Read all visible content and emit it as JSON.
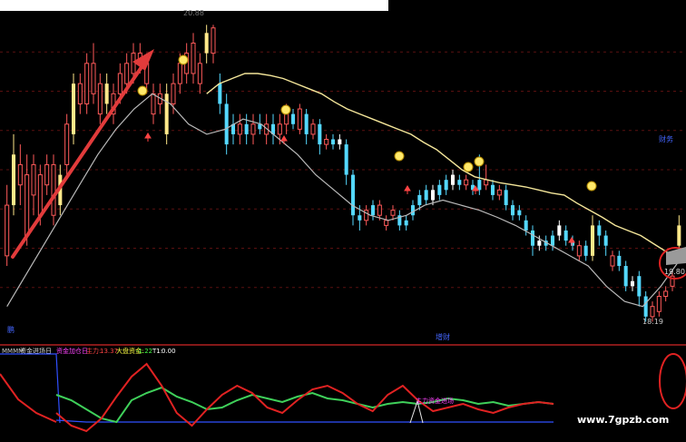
{
  "header": {
    "ticker_prefix": "MMMM",
    "indicator_name": "资金进场日",
    "indicator_name2": "资金加仓日",
    "main_force_label": "主力:",
    "main_force_value": "13.37",
    "big_money_label": "大盘资金:",
    "big_money_value": "-1.22",
    "t1_label": "T1:",
    "t1_value": "0.00"
  },
  "main_panel": {
    "high_label": "20.88",
    "low_label": "18.19",
    "price_tag": "19.80",
    "right_label": "财务",
    "left_label": "鹏",
    "bottom_label": "增财",
    "sub_annotation": "主力资金进场"
  },
  "watermark": "www.7gpzb.com",
  "colors": {
    "up": "#ff5a5a",
    "down": "#54d8ff",
    "flat": "#ffffff",
    "doji_yellow": "#ffe88a",
    "ma_yellow": "#f4e69a",
    "ma_gray": "#b9b9b9",
    "arrow_red": "#e23b3b",
    "grid_red": "#5a1010",
    "line_green": "#3fd05a",
    "line_red": "#e02222",
    "line_blue": "#3050ff"
  },
  "chart_data": {
    "type": "candlestick",
    "price_range": [
      17.9,
      21.0
    ],
    "candles": [
      {
        "o": 18.6,
        "c": 19.1,
        "h": 19.3,
        "l": 18.5,
        "k": "up"
      },
      {
        "o": 19.1,
        "c": 19.6,
        "h": 19.8,
        "l": 19.0,
        "k": "doji"
      },
      {
        "o": 19.5,
        "c": 19.3,
        "h": 19.7,
        "l": 19.1,
        "k": "up"
      },
      {
        "o": 18.8,
        "c": 19.4,
        "h": 19.6,
        "l": 18.7,
        "k": "up"
      },
      {
        "o": 19.2,
        "c": 19.5,
        "h": 19.6,
        "l": 19.0,
        "k": "up"
      },
      {
        "o": 19.0,
        "c": 19.4,
        "h": 19.5,
        "l": 18.9,
        "k": "up"
      },
      {
        "o": 19.3,
        "c": 19.5,
        "h": 19.6,
        "l": 19.2,
        "k": "up"
      },
      {
        "o": 19.0,
        "c": 19.5,
        "h": 19.6,
        "l": 18.9,
        "k": "up"
      },
      {
        "o": 19.1,
        "c": 19.4,
        "h": 19.5,
        "l": 19.0,
        "k": "doji"
      },
      {
        "o": 19.5,
        "c": 19.9,
        "h": 20.0,
        "l": 19.4,
        "k": "up"
      },
      {
        "o": 19.8,
        "c": 20.3,
        "h": 20.4,
        "l": 19.7,
        "k": "doji"
      },
      {
        "o": 20.1,
        "c": 20.3,
        "h": 20.4,
        "l": 20.0,
        "k": "up"
      },
      {
        "o": 20.1,
        "c": 20.5,
        "h": 20.6,
        "l": 20.0,
        "k": "up"
      },
      {
        "o": 20.2,
        "c": 20.5,
        "h": 20.7,
        "l": 20.1,
        "k": "up"
      },
      {
        "o": 20.0,
        "c": 20.3,
        "h": 20.4,
        "l": 19.9,
        "k": "up"
      },
      {
        "o": 20.1,
        "c": 20.3,
        "h": 20.4,
        "l": 20.0,
        "k": "doji"
      },
      {
        "o": 20.0,
        "c": 20.2,
        "h": 20.3,
        "l": 19.9,
        "k": "up"
      },
      {
        "o": 20.2,
        "c": 20.4,
        "h": 20.5,
        "l": 20.1,
        "k": "up"
      },
      {
        "o": 20.3,
        "c": 20.5,
        "h": 20.6,
        "l": 20.2,
        "k": "up"
      },
      {
        "o": 20.4,
        "c": 20.6,
        "h": 20.7,
        "l": 20.3,
        "k": "up"
      },
      {
        "o": 20.5,
        "c": 20.6,
        "h": 20.7,
        "l": 20.4,
        "k": "up"
      },
      {
        "o": 20.3,
        "c": 20.5,
        "h": 20.6,
        "l": 20.2,
        "k": "up"
      },
      {
        "o": 20.0,
        "c": 20.2,
        "h": 20.3,
        "l": 19.9,
        "k": "up"
      },
      {
        "o": 20.2,
        "c": 20.1,
        "h": 20.3,
        "l": 20.0,
        "k": "up"
      },
      {
        "o": 19.8,
        "c": 20.2,
        "h": 20.3,
        "l": 19.7,
        "k": "doji"
      },
      {
        "o": 20.1,
        "c": 20.3,
        "h": 20.4,
        "l": 20.0,
        "k": "up"
      },
      {
        "o": 20.3,
        "c": 20.5,
        "h": 20.6,
        "l": 20.2,
        "k": "up"
      },
      {
        "o": 20.4,
        "c": 20.6,
        "h": 20.7,
        "l": 20.3,
        "k": "up"
      },
      {
        "o": 20.4,
        "c": 20.7,
        "h": 20.8,
        "l": 20.3,
        "k": "up"
      },
      {
        "o": 20.5,
        "c": 20.3,
        "h": 20.6,
        "l": 20.2,
        "k": "up"
      },
      {
        "o": 20.6,
        "c": 20.8,
        "h": 20.88,
        "l": 20.5,
        "k": "doji"
      },
      {
        "o": 20.6,
        "c": 20.85,
        "h": 20.88,
        "l": 20.5,
        "k": "up"
      },
      {
        "o": 20.3,
        "c": 20.1,
        "h": 20.4,
        "l": 20.0,
        "k": "down"
      },
      {
        "o": 20.1,
        "c": 19.7,
        "h": 20.2,
        "l": 19.6,
        "k": "down"
      },
      {
        "o": 19.9,
        "c": 19.8,
        "h": 20.0,
        "l": 19.7,
        "k": "down"
      },
      {
        "o": 19.8,
        "c": 19.9,
        "h": 20.0,
        "l": 19.7,
        "k": "up"
      },
      {
        "o": 19.9,
        "c": 19.8,
        "h": 20.0,
        "l": 19.7,
        "k": "down"
      },
      {
        "o": 19.8,
        "c": 19.9,
        "h": 20.0,
        "l": 19.7,
        "k": "up"
      },
      {
        "o": 19.9,
        "c": 19.85,
        "h": 20.0,
        "l": 19.8,
        "k": "down"
      },
      {
        "o": 19.8,
        "c": 19.9,
        "h": 20.0,
        "l": 19.7,
        "k": "up"
      },
      {
        "o": 19.9,
        "c": 19.8,
        "h": 20.0,
        "l": 19.7,
        "k": "down"
      },
      {
        "o": 19.8,
        "c": 19.9,
        "h": 20.0,
        "l": 19.7,
        "k": "up"
      },
      {
        "o": 19.9,
        "c": 20.0,
        "h": 20.1,
        "l": 19.8,
        "k": "up"
      },
      {
        "o": 19.9,
        "c": 20.0,
        "h": 20.05,
        "l": 19.85,
        "k": "down"
      },
      {
        "o": 19.85,
        "c": 20.05,
        "h": 20.1,
        "l": 19.8,
        "k": "up"
      },
      {
        "o": 20.0,
        "c": 19.8,
        "h": 20.05,
        "l": 19.7,
        "k": "down"
      },
      {
        "o": 19.8,
        "c": 19.9,
        "h": 19.95,
        "l": 19.75,
        "k": "up"
      },
      {
        "o": 19.9,
        "c": 19.7,
        "h": 19.95,
        "l": 19.6,
        "k": "down"
      },
      {
        "o": 19.7,
        "c": 19.75,
        "h": 19.8,
        "l": 19.65,
        "k": "up"
      },
      {
        "o": 19.75,
        "c": 19.7,
        "h": 19.8,
        "l": 19.65,
        "k": "down"
      },
      {
        "o": 19.7,
        "c": 19.75,
        "h": 19.8,
        "l": 19.65,
        "k": "flat"
      },
      {
        "o": 19.7,
        "c": 19.4,
        "h": 19.75,
        "l": 19.3,
        "k": "down"
      },
      {
        "o": 19.4,
        "c": 19.0,
        "h": 19.45,
        "l": 18.9,
        "k": "down"
      },
      {
        "o": 19.0,
        "c": 18.95,
        "h": 19.1,
        "l": 18.85,
        "k": "down"
      },
      {
        "o": 18.95,
        "c": 19.05,
        "h": 19.1,
        "l": 18.9,
        "k": "up"
      },
      {
        "o": 19.1,
        "c": 19.0,
        "h": 19.15,
        "l": 18.95,
        "k": "down"
      },
      {
        "o": 19.0,
        "c": 19.1,
        "h": 19.15,
        "l": 18.95,
        "k": "up"
      },
      {
        "o": 18.9,
        "c": 18.95,
        "h": 19.0,
        "l": 18.85,
        "k": "up"
      },
      {
        "o": 19.0,
        "c": 19.05,
        "h": 19.1,
        "l": 18.95,
        "k": "up"
      },
      {
        "o": 19.0,
        "c": 18.9,
        "h": 19.05,
        "l": 18.85,
        "k": "down"
      },
      {
        "o": 18.9,
        "c": 18.95,
        "h": 19.0,
        "l": 18.85,
        "k": "down"
      },
      {
        "o": 19.0,
        "c": 19.1,
        "h": 19.15,
        "l": 18.95,
        "k": "down"
      },
      {
        "o": 19.1,
        "c": 19.2,
        "h": 19.25,
        "l": 19.05,
        "k": "down"
      },
      {
        "o": 19.15,
        "c": 19.25,
        "h": 19.3,
        "l": 19.1,
        "k": "down"
      },
      {
        "o": 19.15,
        "c": 19.25,
        "h": 19.3,
        "l": 19.1,
        "k": "flat"
      },
      {
        "o": 19.2,
        "c": 19.3,
        "h": 19.35,
        "l": 19.15,
        "k": "down"
      },
      {
        "o": 19.25,
        "c": 19.35,
        "h": 19.4,
        "l": 19.2,
        "k": "down"
      },
      {
        "o": 19.3,
        "c": 19.4,
        "h": 19.45,
        "l": 19.25,
        "k": "flat"
      },
      {
        "o": 19.35,
        "c": 19.3,
        "h": 19.4,
        "l": 19.25,
        "k": "down"
      },
      {
        "o": 19.3,
        "c": 19.35,
        "h": 19.4,
        "l": 19.25,
        "k": "up"
      },
      {
        "o": 19.3,
        "c": 19.25,
        "h": 19.35,
        "l": 19.2,
        "k": "down"
      },
      {
        "o": 19.25,
        "c": 19.35,
        "h": 19.6,
        "l": 19.2,
        "k": "down"
      },
      {
        "o": 19.35,
        "c": 19.3,
        "h": 19.5,
        "l": 19.25,
        "k": "up"
      },
      {
        "o": 19.3,
        "c": 19.2,
        "h": 19.35,
        "l": 19.15,
        "k": "down"
      },
      {
        "o": 19.2,
        "c": 19.25,
        "h": 19.3,
        "l": 19.15,
        "k": "up"
      },
      {
        "o": 19.25,
        "c": 19.1,
        "h": 19.3,
        "l": 19.05,
        "k": "down"
      },
      {
        "o": 19.1,
        "c": 19.0,
        "h": 19.15,
        "l": 18.95,
        "k": "down"
      },
      {
        "o": 19.0,
        "c": 19.05,
        "h": 19.1,
        "l": 18.95,
        "k": "down"
      },
      {
        "o": 18.95,
        "c": 18.85,
        "h": 19.0,
        "l": 18.8,
        "k": "down"
      },
      {
        "o": 18.85,
        "c": 18.7,
        "h": 18.9,
        "l": 18.6,
        "k": "down"
      },
      {
        "o": 18.7,
        "c": 18.75,
        "h": 18.8,
        "l": 18.65,
        "k": "flat"
      },
      {
        "o": 18.75,
        "c": 18.7,
        "h": 18.8,
        "l": 18.65,
        "k": "down"
      },
      {
        "o": 18.7,
        "c": 18.8,
        "h": 18.85,
        "l": 18.65,
        "k": "down"
      },
      {
        "o": 18.8,
        "c": 18.9,
        "h": 18.95,
        "l": 18.75,
        "k": "flat"
      },
      {
        "o": 18.85,
        "c": 18.75,
        "h": 18.9,
        "l": 18.7,
        "k": "down"
      },
      {
        "o": 18.75,
        "c": 18.7,
        "h": 18.8,
        "l": 18.65,
        "k": "down"
      },
      {
        "o": 18.7,
        "c": 18.6,
        "h": 18.75,
        "l": 18.55,
        "k": "up"
      },
      {
        "o": 18.6,
        "c": 18.7,
        "h": 18.75,
        "l": 18.55,
        "k": "down"
      },
      {
        "o": 18.6,
        "c": 18.9,
        "h": 19.0,
        "l": 18.55,
        "k": "doji"
      },
      {
        "o": 18.9,
        "c": 18.8,
        "h": 18.95,
        "l": 18.7,
        "k": "down"
      },
      {
        "o": 18.8,
        "c": 18.7,
        "h": 18.85,
        "l": 18.6,
        "k": "down"
      },
      {
        "o": 18.6,
        "c": 18.5,
        "h": 18.65,
        "l": 18.45,
        "k": "up"
      },
      {
        "o": 18.6,
        "c": 18.5,
        "h": 18.65,
        "l": 18.45,
        "k": "down"
      },
      {
        "o": 18.5,
        "c": 18.3,
        "h": 18.55,
        "l": 18.25,
        "k": "down"
      },
      {
        "o": 18.3,
        "c": 18.35,
        "h": 18.4,
        "l": 18.25,
        "k": "flat"
      },
      {
        "o": 18.4,
        "c": 18.2,
        "h": 18.45,
        "l": 18.1,
        "k": "down"
      },
      {
        "o": 18.2,
        "c": 18.0,
        "h": 18.25,
        "l": 17.95,
        "k": "down"
      },
      {
        "o": 18.0,
        "c": 18.1,
        "h": 18.15,
        "l": 17.95,
        "k": "up"
      },
      {
        "o": 18.05,
        "c": 18.2,
        "h": 18.25,
        "l": 18.0,
        "k": "up"
      },
      {
        "o": 18.2,
        "c": 18.25,
        "h": 18.3,
        "l": 18.15,
        "k": "up"
      },
      {
        "o": 18.3,
        "c": 18.4,
        "h": 18.45,
        "l": 18.25,
        "k": "up"
      },
      {
        "o": 18.7,
        "c": 18.9,
        "h": 19.0,
        "l": 18.6,
        "k": "doji"
      }
    ],
    "ma_yellow": [
      20.2,
      20.3,
      20.35,
      20.4,
      20.4,
      20.38,
      20.35,
      20.3,
      20.25,
      20.2,
      20.12,
      20.05,
      20.0,
      19.95,
      19.9,
      19.85,
      19.8,
      19.72,
      19.65,
      19.55,
      19.45,
      19.38,
      19.35,
      19.32,
      19.3,
      19.28,
      19.25,
      19.22,
      19.2,
      19.12,
      19.05,
      18.98,
      18.9,
      18.85,
      18.8,
      18.72,
      18.64,
      18.56
    ],
    "ma_gray": [
      18.1,
      18.4,
      18.7,
      19.0,
      19.3,
      19.6,
      19.85,
      20.05,
      20.2,
      20.1,
      19.9,
      19.8,
      19.85,
      19.95,
      19.9,
      19.75,
      19.6,
      19.4,
      19.25,
      19.1,
      19.0,
      18.95,
      19.0,
      19.1,
      19.15,
      19.1,
      19.05,
      18.98,
      18.9,
      18.8,
      18.7,
      18.6,
      18.5,
      18.3,
      18.15,
      18.1,
      18.3,
      18.55
    ],
    "sub_green": [
      0.5,
      0.2,
      -0.3,
      -0.8,
      -1.0,
      0.2,
      0.6,
      0.9,
      0.4,
      0.1,
      -0.3,
      -0.2,
      0.2,
      0.5,
      0.3,
      0.1,
      0.4,
      0.6,
      0.3,
      0.2,
      0.0,
      -0.2,
      0.0,
      0.1,
      0.0,
      0.1,
      0.3,
      0.2,
      0.0,
      0.1,
      -0.1,
      0.0,
      0.1,
      0.0
    ],
    "sub_red": [
      -0.5,
      -1.2,
      -1.5,
      -0.8,
      0.4,
      1.5,
      2.2,
      1.0,
      -0.5,
      -1.2,
      -0.3,
      0.5,
      1.0,
      0.6,
      -0.2,
      -0.5,
      0.2,
      0.8,
      1.0,
      0.6,
      0.0,
      -0.4,
      0.5,
      1.0,
      0.2,
      -0.4,
      -0.2,
      0.0,
      -0.3,
      -0.5,
      -0.2,
      0.0,
      0.1,
      0.0
    ],
    "sub_blue": [
      -0.9,
      -0.95,
      -1.0,
      -1.0,
      -1.0,
      -1.0,
      -1.0,
      -1.0,
      -1.0,
      -1.0,
      -1.0,
      -1.0,
      -1.0,
      -1.0,
      -1.0,
      -1.0,
      -1.0,
      -1.0,
      -1.0,
      -1.0,
      -1.0,
      -1.0,
      -1.0,
      -1.0,
      -1.0,
      -1.0,
      -1.0,
      -1.0,
      -1.0,
      -1.0,
      -1.0,
      -1.0,
      -1.0,
      -1.0
    ]
  }
}
